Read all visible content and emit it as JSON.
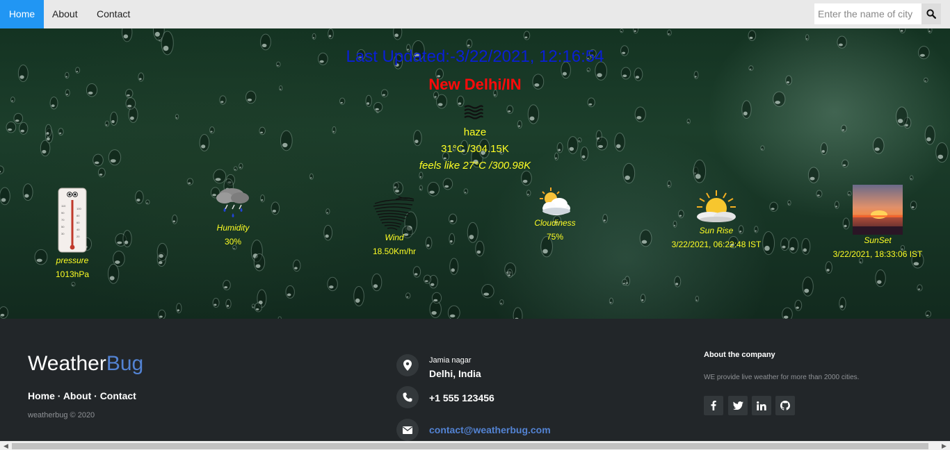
{
  "nav": {
    "home": "Home",
    "about": "About",
    "contact": "Contact",
    "search_placeholder": "Enter the name of city"
  },
  "weather": {
    "last_updated": "Last Updated:-3/22/2021, 12:16:54",
    "city": "New Delhi/IN",
    "description": "haze",
    "temperature": "31°C /304.15K",
    "feels_like": "feels like 27°C /300.98K"
  },
  "stats": {
    "pressure": {
      "label": "pressure",
      "value": "1013hPa"
    },
    "humidity": {
      "label": "Humidity",
      "value": "30%"
    },
    "wind": {
      "label": "Wind",
      "value": "18.50Km/hr"
    },
    "cloudiness": {
      "label": "Cloudiness",
      "value": "75%"
    },
    "sunrise": {
      "label": "Sun Rise",
      "value": "3/22/2021, 06:22:48 IST"
    },
    "sunset": {
      "label": "SunSet",
      "value": "3/22/2021, 18:33:06 IST"
    }
  },
  "footer": {
    "logo_part1": "Weather",
    "logo_part2": "Bug",
    "links": "Home · About · Contact",
    "copyright": "weatherbug © 2020",
    "address_line1": "Jamia nagar",
    "address_line2": "Delhi, India",
    "phone": "+1 555 123456",
    "email": "contact@weatherbug.com",
    "about_heading": "About the company",
    "about_text": "WE provide live weather for more than 2000 cities."
  },
  "colors": {
    "nav_active": "#2196f3",
    "updated_text": "#0a1fd6",
    "city_text": "#ff0a0a",
    "weather_text": "#ffff24",
    "footer_bg": "#222629",
    "footer_accent": "#5383d3"
  },
  "icons": {
    "search": "search-icon",
    "weather": "haze-icon",
    "pressure": "thermometer-icon",
    "humidity": "rain-cloud-icon",
    "wind": "wind-swirl-icon",
    "cloudiness": "sun-cloud-icon",
    "sunrise": "sunrise-icon",
    "sunset": "sunset-photo-icon",
    "address": "map-pin-icon",
    "phone": "phone-icon",
    "email": "envelope-icon",
    "social": [
      "facebook-icon",
      "twitter-icon",
      "linkedin-icon",
      "github-icon"
    ]
  }
}
